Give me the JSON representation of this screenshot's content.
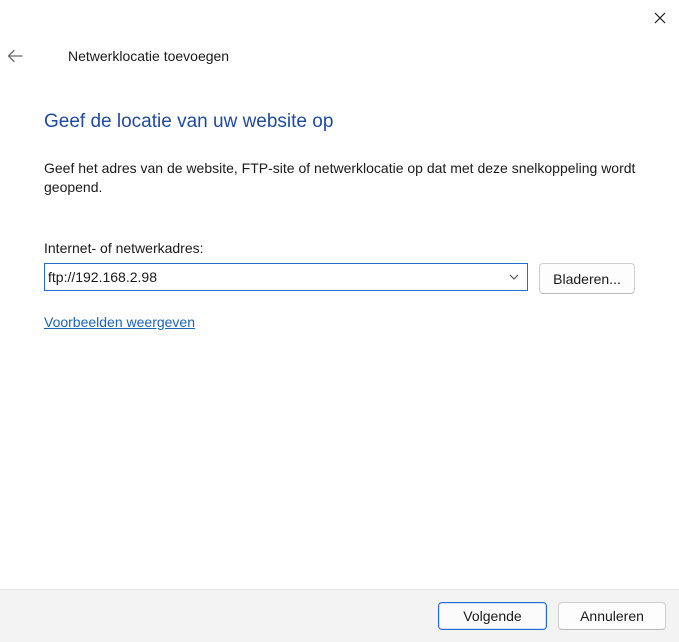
{
  "dialog": {
    "title": "Netwerklocatie toevoegen",
    "heading": "Geef de locatie van uw website op",
    "description": "Geef het adres van de website, FTP-site of netwerklocatie op dat met deze snelkoppeling wordt geopend.",
    "address_label": "Internet- of netwerkadres:",
    "address_value": "ftp://192.168.2.98",
    "browse_label": "Bladeren...",
    "examples_link": "Voorbeelden weergeven"
  },
  "footer": {
    "next_label": "Volgende",
    "cancel_label": "Annuleren"
  },
  "icons": {
    "close": "close-icon",
    "back": "back-arrow-icon",
    "dropdown": "chevron-down-icon"
  },
  "colors": {
    "heading": "#1f4ba5",
    "link": "#1a63b8",
    "focus_border": "#1f6fcf",
    "footer_background": "#f3f3f3"
  }
}
